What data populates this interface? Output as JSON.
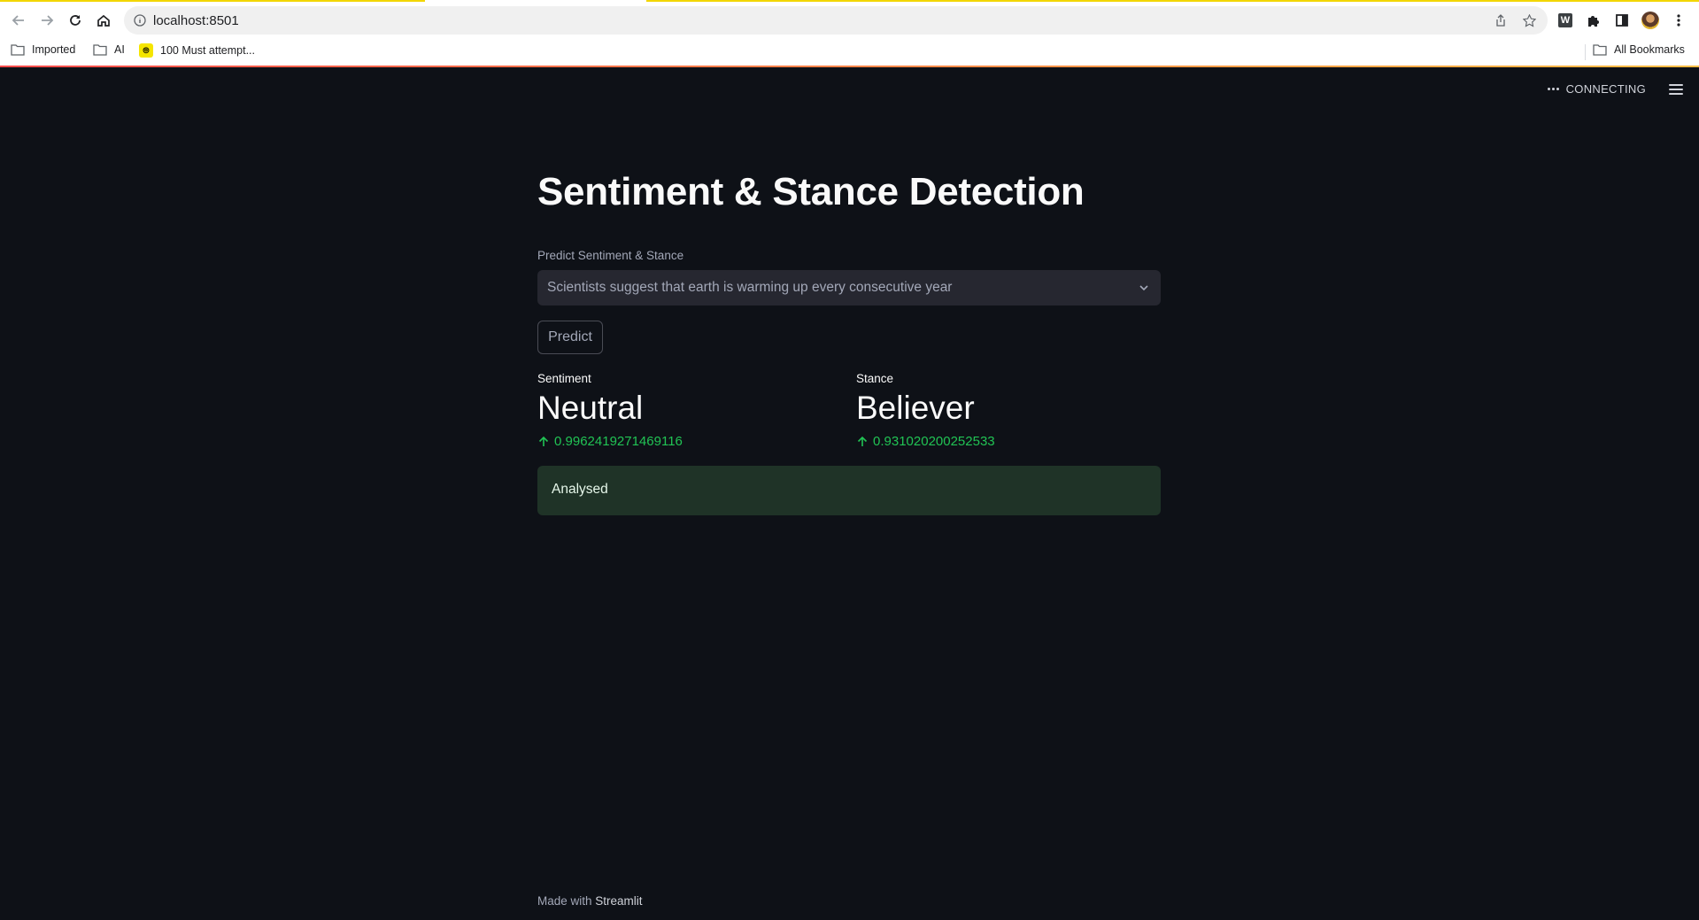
{
  "browser": {
    "url": "localhost:8501",
    "bookmarks": [
      {
        "label": "Imported",
        "icon": "folder-icon"
      },
      {
        "label": "AI",
        "icon": "folder-icon"
      },
      {
        "label": "100 Must attempt...",
        "icon": "favicon"
      }
    ],
    "all_bookmarks_label": "All Bookmarks",
    "extensions": [
      "w-extension-icon",
      "puzzle-icon",
      "sidepanel-icon",
      "profile-avatar"
    ]
  },
  "app": {
    "status_text": "CONNECTING",
    "title": "Sentiment & Stance Detection",
    "select": {
      "label": "Predict Sentiment & Stance",
      "value": "Scientists suggest that earth is warming up every consecutive year"
    },
    "predict_button": "Predict",
    "metrics": [
      {
        "label": "Sentiment",
        "value": "Neutral",
        "delta": "0.9962419271469116"
      },
      {
        "label": "Stance",
        "value": "Believer",
        "delta": "0.931020200252533"
      }
    ],
    "alert": "Analysed",
    "footer": {
      "prefix": "Made with ",
      "brand": "Streamlit"
    }
  },
  "colors": {
    "background": "#0e1117",
    "select_bg": "#262730",
    "delta_green": "#21c354",
    "success_bg": "#1f3327",
    "accent_gradient_start": "#ff4b4b",
    "accent_gradient_end": "#ffbd45"
  }
}
